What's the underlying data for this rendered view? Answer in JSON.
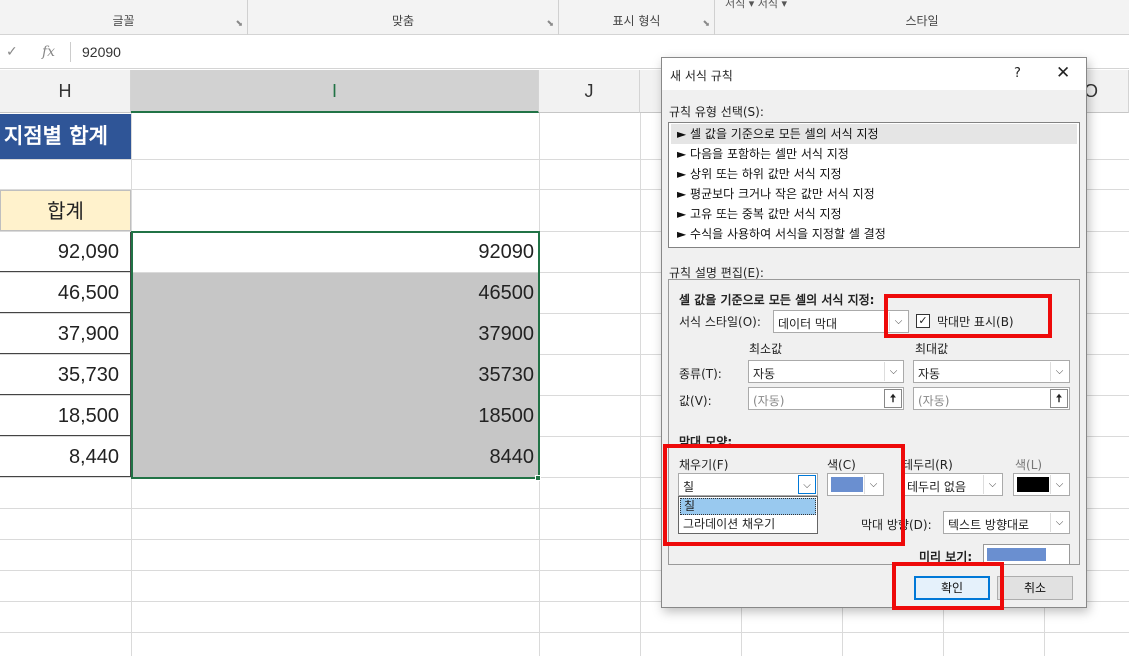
{
  "ribbon": {
    "groups": [
      "글꼴",
      "맞춤",
      "표시 형식",
      "스타일"
    ],
    "top_text": "서식 ▾  서식 ▾"
  },
  "formula_bar": {
    "cancel": "✓",
    "fx": "fx",
    "value": "92090"
  },
  "columns": [
    "H",
    "I",
    "J",
    "O"
  ],
  "sheet": {
    "title": "지점별 합계",
    "total_header": "합계",
    "h_values": [
      "92,090",
      "46,500",
      "37,900",
      "35,730",
      "18,500",
      "8,440"
    ],
    "i_values": [
      "92090",
      "46500",
      "37900",
      "35730",
      "18500",
      "8440"
    ]
  },
  "dialog": {
    "title": "새 서식 규칙",
    "help": "?",
    "close": "✕",
    "rule_type_label": "규칙 유형 선택(S):",
    "rule_types": [
      "► 셀 값을 기준으로 모든 셀의 서식 지정",
      "► 다음을 포함하는 셀만 서식 지정",
      "► 상위 또는 하위 값만 서식 지정",
      "► 평균보다 크거나 작은 값만 서식 지정",
      "► 고유 또는 중복 값만 서식 지정",
      "► 수식을 사용하여 서식을 지정할 셀 결정"
    ],
    "edit_label": "규칙 설명 편집(E):",
    "section_title": "셀 값을 기준으로 모든 셀의 서식 지정:",
    "format_style_label": "서식 스타일(O):",
    "format_style_value": "데이터 막대",
    "bar_only_label": "막대만 표시(B)",
    "bar_only_checked": true,
    "min_label": "최소값",
    "max_label": "최대값",
    "type_label": "종류(T):",
    "value_label": "값(V):",
    "min_type": "자동",
    "max_type": "자동",
    "min_value": "(자동)",
    "max_value": "(자동)",
    "bar_appearance_label": "막대 모양:",
    "fill_label": "채우기(F)",
    "fill_value": "칠",
    "fill_options": [
      "칠",
      "그라데이션 채우기"
    ],
    "color_label": "색(C)",
    "fill_color": "#6a8fd0",
    "border_label": "테두리(R)",
    "border_value": "테두리 없음",
    "border_color_label": "색(L)",
    "border_color": "#000000",
    "direction_label": "막대 방향(D):",
    "direction_value": "텍스트 방향대로",
    "preview_label": "미리 보기:",
    "ok": "확인",
    "cancel": "취소"
  },
  "colors": {
    "header_fill": "#2f5597",
    "total_fill": "#fff2cc",
    "selection": "#217346",
    "highlight": "#ee0a0a"
  }
}
